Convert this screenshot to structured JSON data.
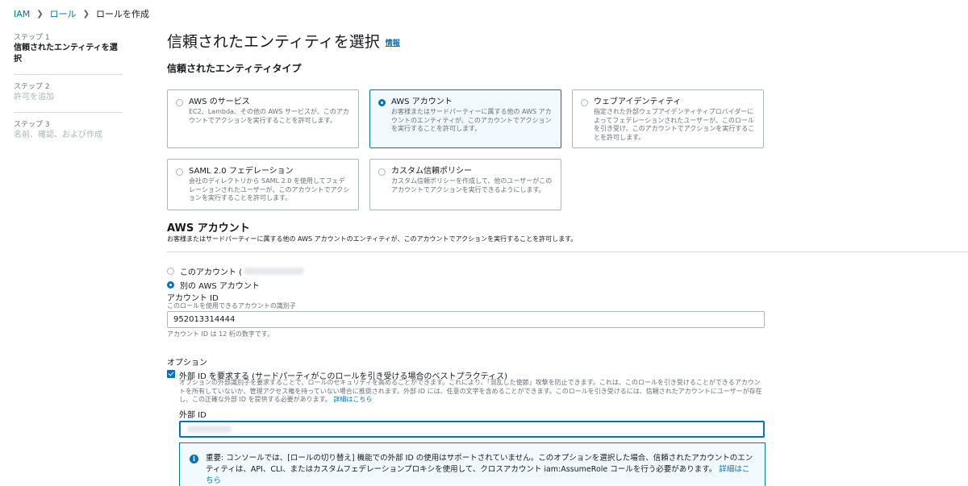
{
  "breadcrumb": {
    "iam": "IAM",
    "roles": "ロール",
    "current": "ロールを作成"
  },
  "steps": [
    {
      "num": "ステップ 1",
      "title": "信頼されたエンティティを選択"
    },
    {
      "num": "ステップ 2",
      "title": "許可を追加"
    },
    {
      "num": "ステップ 3",
      "title": "名前、確認、および作成"
    }
  ],
  "page": {
    "title": "信頼されたエンティティを選択",
    "info": "情報",
    "section_title": "信頼されたエンティティタイプ"
  },
  "entity_types": [
    {
      "title": "AWS のサービス",
      "desc": "EC2、Lambda、その他の AWS サービスが、このアカウントでアクションを実行することを許可します。",
      "selected": false
    },
    {
      "title": "AWS アカウント",
      "desc": "お客様またはサードパーティーに属する他の AWS アカウントのエンティティが、このアカウントでアクションを実行することを許可します。",
      "selected": true
    },
    {
      "title": "ウェブアイデンティティ",
      "desc": "指定された外部ウェブアイデンティティプロバイダーによってフェデレーションされたユーザーが、このロールを引き受け、このアカウントでアクションを実行することを許可します。",
      "selected": false
    },
    {
      "title": "SAML 2.0 フェデレーション",
      "desc": "会社のディレクトリから SAML 2.0 を使用してフェデレーションされたユーザーが、このアカウントでアクションを実行することを許可します。",
      "selected": false
    },
    {
      "title": "カスタム信頼ポリシー",
      "desc": "カスタム信頼ポリシーを作成して、他のユーザーがこのアカウントでアクションを実行できるようにします。",
      "selected": false
    }
  ],
  "aws_account": {
    "title": "AWS アカウント",
    "desc": "お客様またはサードパーティーに属する他の AWS アカウントのエンティティが、このアカウントでアクションを実行することを許可します。",
    "this_account": "このアカウント (",
    "other_account": "別の AWS アカウント",
    "account_id_label": "アカウント ID",
    "account_id_desc": "このロールを使用できるアカウントの識別子",
    "account_id_value": "952013314444",
    "account_id_hint": "アカウント ID は 12 桁の数字です。"
  },
  "options": {
    "label": "オプション",
    "require_external_id": "外部 ID を要求する (サードパーティがこのロールを引き受ける場合のベストプラクティス)",
    "desc": "オプションの外部識別子を要求することで、ロールのセキュリティを高めることができます。これにより、「混乱した使節」攻撃を防止できます。これは、このロールを引き受けることができるアカウントを所有していないか、管理アクセス権を持っていない場合に推奨されます。外部 ID には、任意の文字を含めることができます。このロールを引き受けるには、信頼されたアカウントにユーザーが存在し、この正確な外部 ID を提供する必要があります。",
    "learn_more": "詳細はこちら",
    "external_id_label": "外部 ID"
  },
  "alert": {
    "text": "重要: コンソールでは、[ロールの切り替え] 機能での外部 ID の使用はサポートされていません。このオプションを選択した場合、信頼されたアカウントのエンティティは、API、CLI、またはカスタムフェデレーションプロキシを使用して、クロスアカウント iam:AssumeRole コールを行う必要があります。",
    "link": "詳細はこちら"
  }
}
